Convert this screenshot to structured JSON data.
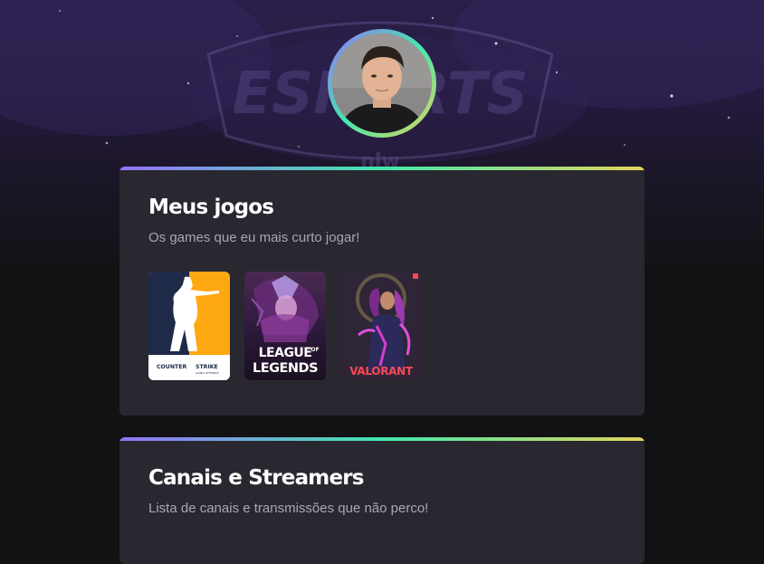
{
  "colors": {
    "page_bg": "#121214",
    "card_bg": "#29272f",
    "gradient_start": "#9572fc",
    "gradient_mid": "#43e7ad",
    "gradient_end": "#e2d45c",
    "title_color": "#ffffff",
    "subtitle_color": "#a8a8b3"
  },
  "background": {
    "art_text": "ESPORTS",
    "art_sub": "nlw"
  },
  "profile": {
    "avatar_icon": "user-photo"
  },
  "games_section": {
    "title": "Meus jogos",
    "subtitle": "Os games que eu mais curto jogar!",
    "games": [
      {
        "name": "Counter-Strike",
        "logo_top": "COUNTER",
        "logo_right": "STRIKE",
        "logo_small": "GLOBAL OFFENSIVE"
      },
      {
        "name": "League of Legends",
        "logo_line1": "LEAGUE",
        "logo_of": "OF",
        "logo_line2": "LEGENDS"
      },
      {
        "name": "Valorant",
        "logo": "VALORANT"
      }
    ]
  },
  "streamers_section": {
    "title": "Canais e Streamers",
    "subtitle": "Lista de canais e transmissões que não perco!"
  }
}
